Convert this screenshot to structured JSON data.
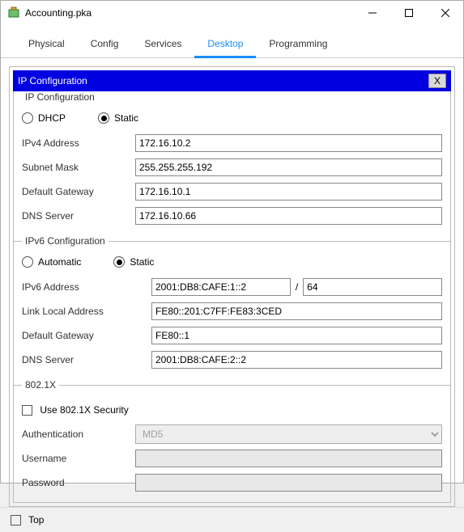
{
  "window": {
    "title": "Accounting.pka"
  },
  "tabs": [
    "Physical",
    "Config",
    "Services",
    "Desktop",
    "Programming"
  ],
  "active_tab": "Desktop",
  "app": {
    "title": "IP Configuration",
    "close": "X"
  },
  "ipv4": {
    "legend": "IP Configuration",
    "dhcp_label": "DHCP",
    "static_label": "Static",
    "mode": "static",
    "addr_label": "IPv4 Address",
    "addr": "172.16.10.2",
    "mask_label": "Subnet Mask",
    "mask": "255.255.255.192",
    "gw_label": "Default Gateway",
    "gw": "172.16.10.1",
    "dns_label": "DNS Server",
    "dns": "172.16.10.66"
  },
  "ipv6": {
    "legend": "IPv6 Configuration",
    "auto_label": "Automatic",
    "static_label": "Static",
    "mode": "static",
    "addr_label": "IPv6 Address",
    "addr": "2001:DB8:CAFE:1::2",
    "prefix": "64",
    "ll_label": "Link Local Address",
    "ll": "FE80::201:C7FF:FE83:3CED",
    "gw_label": "Default Gateway",
    "gw": "FE80::1",
    "dns_label": "DNS Server",
    "dns": "2001:DB8:CAFE:2::2"
  },
  "dot1x": {
    "legend": "802.1X",
    "use_label": "Use 802.1X Security",
    "use": false,
    "auth_label": "Authentication",
    "auth": "MD5",
    "user_label": "Username",
    "user": "",
    "pass_label": "Password",
    "pass": ""
  },
  "footer": {
    "top_label": "Top",
    "top": false
  }
}
